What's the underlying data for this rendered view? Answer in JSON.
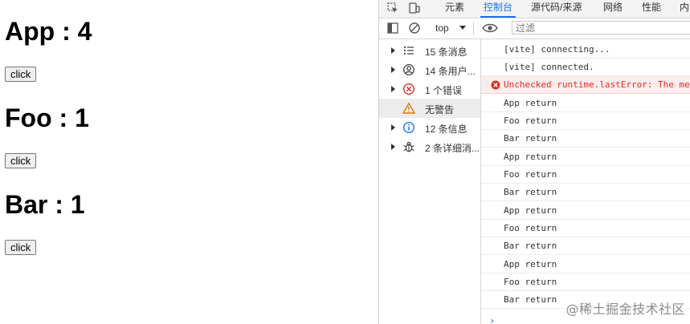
{
  "app": {
    "sections": [
      {
        "title": "App : 4",
        "button_label": "click"
      },
      {
        "title": "Foo : 1",
        "button_label": "click"
      },
      {
        "title": "Bar : 1",
        "button_label": "click"
      }
    ]
  },
  "devtools": {
    "tabs": [
      "元素",
      "控制台",
      "源代码/来源",
      "网络",
      "性能",
      "内"
    ],
    "active_tab": "控制台",
    "toolbar": {
      "context": "top",
      "filter_placeholder": "过滤"
    },
    "sidebar": [
      {
        "label": "15 条消息",
        "icon": "list-icon"
      },
      {
        "label": "14 条用户...",
        "icon": "user-icon"
      },
      {
        "label": "1 个错误",
        "icon": "error-icon"
      },
      {
        "label": "无警告",
        "icon": "warning-icon"
      },
      {
        "label": "12 条信息",
        "icon": "info-icon"
      },
      {
        "label": "2 条详细消...",
        "icon": "bug-icon"
      }
    ],
    "messages": [
      {
        "text": "[vite] connecting...",
        "level": "log"
      },
      {
        "text": "[vite] connected.",
        "level": "log"
      },
      {
        "text": "Unchecked runtime.lastError: The mes",
        "level": "error"
      },
      {
        "text": "App return",
        "level": "log"
      },
      {
        "text": "Foo return",
        "level": "log"
      },
      {
        "text": "Bar return",
        "level": "log"
      },
      {
        "text": "App return",
        "level": "log"
      },
      {
        "text": "Foo return",
        "level": "log"
      },
      {
        "text": "Bar return",
        "level": "log"
      },
      {
        "text": "App return",
        "level": "log"
      },
      {
        "text": "Foo return",
        "level": "log"
      },
      {
        "text": "Bar return",
        "level": "log"
      },
      {
        "text": "App return",
        "level": "log"
      },
      {
        "text": "Foo return",
        "level": "log"
      },
      {
        "text": "Bar return",
        "level": "log"
      }
    ],
    "prompt_caret": "›"
  },
  "watermark": "@稀土掘金技术社区",
  "colors": {
    "accent": "#1a73e8",
    "error": "#d93025",
    "warning": "#e37400"
  }
}
